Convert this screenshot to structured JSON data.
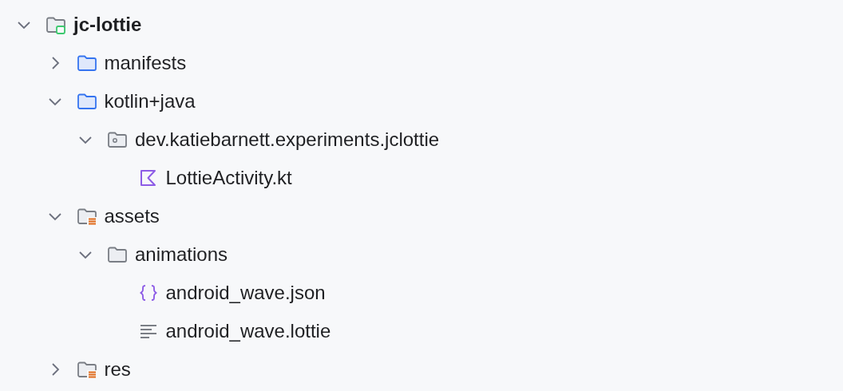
{
  "tree": [
    {
      "label": "jc-lottie",
      "kind": "project",
      "expanded": true,
      "children": [
        {
          "label": "manifests",
          "kind": "source-folder",
          "expanded": false
        },
        {
          "label": "kotlin+java",
          "kind": "source-folder",
          "expanded": true,
          "children": [
            {
              "label": "dev.katiebarnett.experiments.jclottie",
              "kind": "package",
              "expanded": true,
              "children": [
                {
                  "label": "LottieActivity.kt",
                  "kind": "kotlin-file"
                }
              ]
            }
          ]
        },
        {
          "label": "assets",
          "kind": "resource-folder",
          "expanded": true,
          "children": [
            {
              "label": "animations",
              "kind": "folder",
              "expanded": true,
              "children": [
                {
                  "label": "android_wave.json",
                  "kind": "json-file"
                },
                {
                  "label": "android_wave.lottie",
                  "kind": "text-file"
                }
              ]
            }
          ]
        },
        {
          "label": "res",
          "kind": "resource-folder",
          "expanded": false
        }
      ]
    }
  ]
}
